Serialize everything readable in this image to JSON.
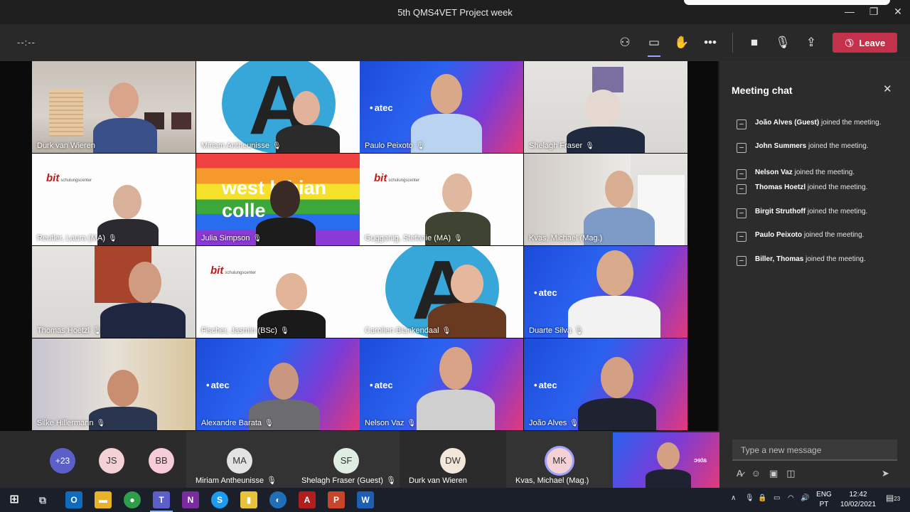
{
  "window": {
    "title": "5th QMS4VET Project week",
    "minimize": "—",
    "maximize": "❐",
    "close": "✕"
  },
  "meeting": {
    "timer": "--:--",
    "leave_label": "Leave"
  },
  "tiles": [
    {
      "name": "Durk van Wieren",
      "muted": false
    },
    {
      "name": "Miriam Antheunisse",
      "muted": true
    },
    {
      "name": "Paulo Peixoto",
      "muted": true
    },
    {
      "name": "Shelagh Fraser",
      "muted": true
    },
    {
      "name": "Reutler, Laura (MA)",
      "muted": true
    },
    {
      "name": "Julia Simpson",
      "muted": true
    },
    {
      "name": "Gugganig, Stefanie (MA)",
      "muted": true
    },
    {
      "name": "Kvas, Michael (Mag.)",
      "muted": false
    },
    {
      "name": "Thomas Hoetzl",
      "muted": true
    },
    {
      "name": "Fischer, Jasmin (BSc)",
      "muted": true
    },
    {
      "name": "Carolien Blankendaal",
      "muted": true
    },
    {
      "name": "Duarte Silva",
      "muted": true
    },
    {
      "name": "Silke Hillermann",
      "muted": true
    },
    {
      "name": "Alexandre Barata",
      "muted": true
    },
    {
      "name": "Nelson Vaz",
      "muted": true
    },
    {
      "name": "João Alves",
      "muted": true
    }
  ],
  "backgrounds": {
    "atec": "atec",
    "bit": "bit",
    "bit_sub": "schulungscenter",
    "west_lothian_1": "west l thian",
    "west_lothian_2": "colle"
  },
  "strip": {
    "more": "+23",
    "avatars": [
      "JS",
      "BB"
    ],
    "tiles": [
      {
        "initials": "MA",
        "name": "Miriam Antheunisse"
      },
      {
        "initials": "SF",
        "name": "Shelagh Fraser (Guest)"
      },
      {
        "initials": "DW",
        "name": "Durk van Wieren"
      },
      {
        "initials": "MK",
        "name": "Kvas, Michael (Mag.)"
      }
    ],
    "self_logo": "atec"
  },
  "chat": {
    "title": "Meeting chat",
    "messages": [
      {
        "who": "João Alves (Guest)",
        "text": " joined the meeting."
      },
      {
        "who": "John Summers",
        "text": " joined the meeting."
      },
      {
        "who": "Nelson Vaz",
        "text": " joined the meeting."
      },
      {
        "who": "Thomas Hoetzl",
        "text": " joined the meeting."
      },
      {
        "who": "Birgit Struthoff",
        "text": " joined the meeting."
      },
      {
        "who": "Paulo Peixoto",
        "text": " joined the meeting."
      },
      {
        "who": "Biller, Thomas",
        "text": " joined the meeting."
      }
    ],
    "compose_placeholder": "Type a new message"
  },
  "taskbar": {
    "lang_1": "ENG",
    "lang_2": "PT",
    "time": "12:42",
    "date": "10/02/2021",
    "notifications": "23"
  },
  "colors": {
    "leave": "#c4314b",
    "accent": "#9ea2ff",
    "teams_purple": "#5b5fc7"
  }
}
